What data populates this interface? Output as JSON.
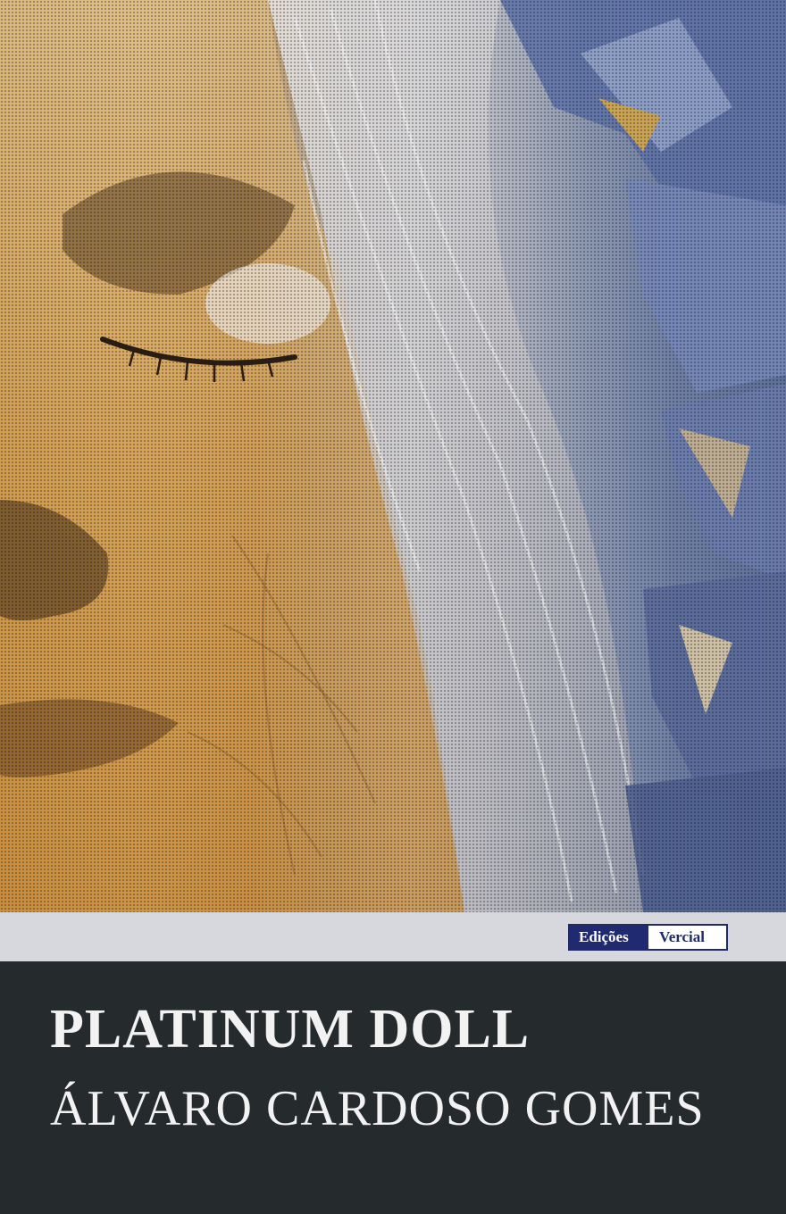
{
  "cover": {
    "title": "PLATINUM DOLL",
    "author": "ÁLVARO CARDOSO GOMES"
  },
  "publisher": {
    "left": "Edições",
    "right": "Vercial"
  },
  "colors": {
    "band": "#252a2d",
    "strip": "#d7d8dd",
    "logo_blue": "#1f2a70",
    "text": "#f2f2f2"
  }
}
